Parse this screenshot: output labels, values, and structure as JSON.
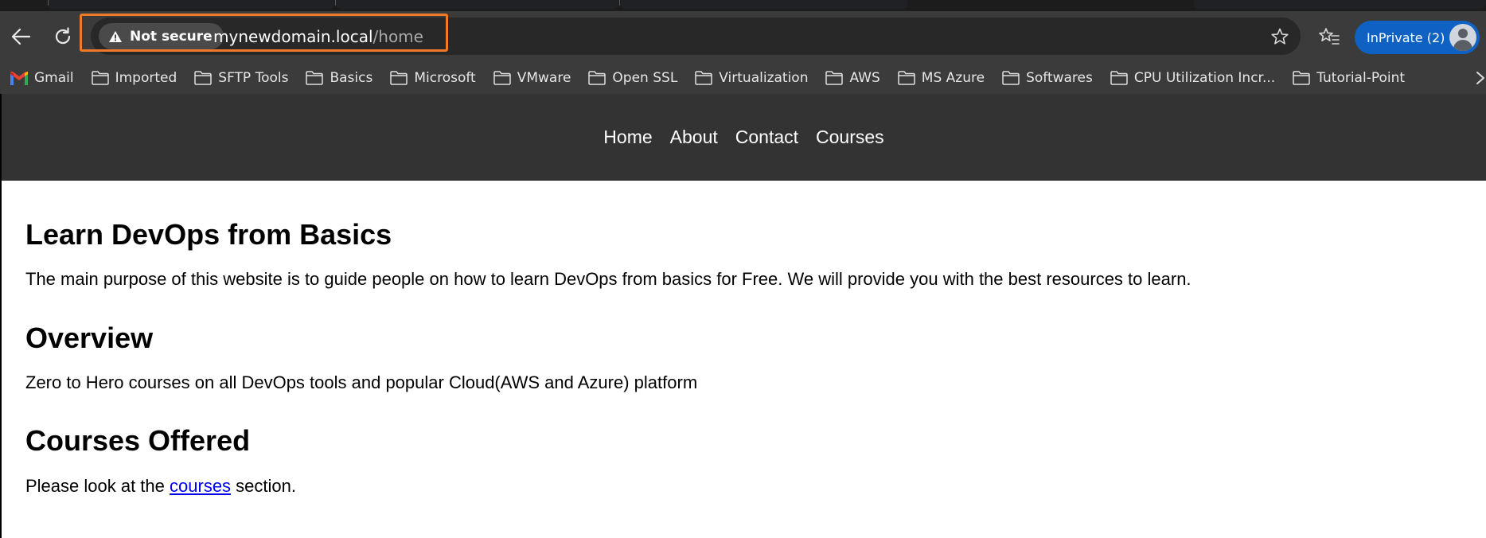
{
  "browser": {
    "security_label": "Not secure",
    "url_host": "mynewdomain.local",
    "url_path": "/home",
    "profile_label": "InPrivate (2)",
    "highlight_color": "#ee7a2a",
    "profile_color": "#0f62c4",
    "icons": [
      "back-arrow-icon",
      "refresh-icon",
      "warning-icon",
      "star-icon",
      "favorites-icon",
      "gmail-icon",
      "folder-icon",
      "chevron-right-icon"
    ]
  },
  "bookmarks": [
    {
      "label": "Gmail",
      "icon": "gmail-icon"
    },
    {
      "label": "Imported",
      "icon": "folder-icon"
    },
    {
      "label": "SFTP Tools",
      "icon": "folder-icon"
    },
    {
      "label": "Basics",
      "icon": "folder-icon"
    },
    {
      "label": "Microsoft",
      "icon": "folder-icon"
    },
    {
      "label": "VMware",
      "icon": "folder-icon"
    },
    {
      "label": "Open SSL",
      "icon": "folder-icon"
    },
    {
      "label": "Virtualization",
      "icon": "folder-icon"
    },
    {
      "label": "AWS",
      "icon": "folder-icon"
    },
    {
      "label": "MS Azure",
      "icon": "folder-icon"
    },
    {
      "label": "Softwares",
      "icon": "folder-icon"
    },
    {
      "label": "CPU Utilization Incr...",
      "icon": "folder-icon"
    },
    {
      "label": "Tutorial-Point",
      "icon": "folder-icon"
    }
  ],
  "site": {
    "nav": [
      "Home",
      "About",
      "Contact",
      "Courses"
    ],
    "heading_learn": "Learn DevOps from Basics",
    "para_learn": "The main purpose of this website is to guide people on how to learn DevOps from basics for Free. We will provide you with the best resources to learn.",
    "heading_overview": "Overview",
    "para_overview": "Zero to Hero courses on all DevOps tools and popular Cloud(AWS and Azure) platform",
    "heading_courses": "Courses Offered",
    "para_courses_before": "Please look at the ",
    "para_courses_link": "courses",
    "para_courses_after": " section."
  }
}
